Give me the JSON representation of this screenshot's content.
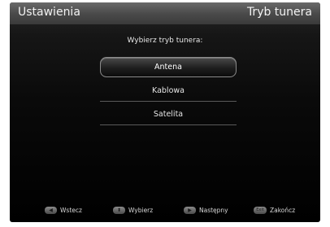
{
  "header": {
    "title": "Ustawienia",
    "section": "Tryb tunera"
  },
  "prompt": "Wybierz tryb tunera:",
  "menu": {
    "items": [
      {
        "label": "Antena",
        "selected": true
      },
      {
        "label": "Kablowa",
        "selected": false
      },
      {
        "label": "Satelita",
        "selected": false
      }
    ]
  },
  "footer": {
    "hints": [
      {
        "key_icon": "left-arrow-icon",
        "key_glyph": "◀",
        "label": "Wstecz"
      },
      {
        "key_icon": "up-down-arrow-icon",
        "key_glyph": "⬍",
        "label": "Wybierz"
      },
      {
        "key_icon": "right-arrow-icon",
        "key_glyph": "▶",
        "label": "Następny"
      },
      {
        "key_icon": "exit-key-icon",
        "key_glyph": "Exit",
        "label": "Zakończ"
      }
    ]
  },
  "colors": {
    "header_bg": "#4b4b4b",
    "screen_bg": "#000000",
    "text": "#e6e6e6",
    "selection_border": "#8a8a8a"
  }
}
